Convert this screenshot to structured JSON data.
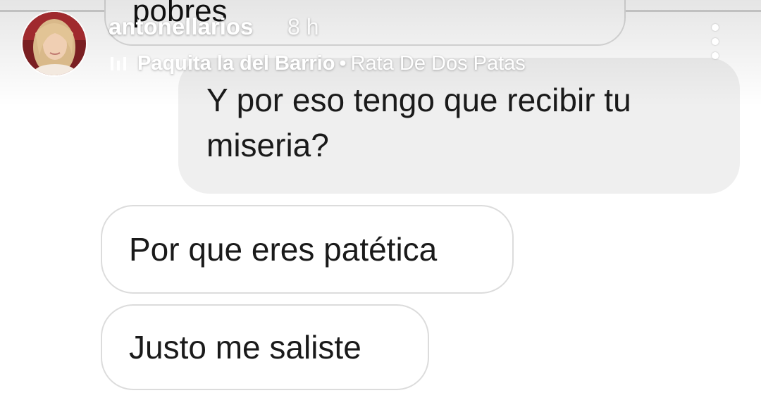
{
  "story_header": {
    "username": "antonellarios",
    "time": "8 h",
    "music": {
      "artist": "Paquita la del Barrio",
      "separator": "•",
      "song": "Rata De Dos Patas"
    },
    "avatar_icon": "profile-photo",
    "more_icon": "vertical-ellipsis"
  },
  "messages": [
    {
      "sender": "other",
      "text": "pobres",
      "style": "outlined",
      "cut_off": true
    },
    {
      "sender": "self",
      "text": "Y por eso tengo que recibir tu miseria?",
      "style": "filled"
    },
    {
      "sender": "other",
      "text": "Por que eres patética",
      "style": "outlined"
    },
    {
      "sender": "other",
      "text": "Justo me saliste",
      "style": "outlined"
    }
  ],
  "colors": {
    "own_bubble": "#efefef",
    "other_bubble_border": "#dcdcdc",
    "header_text": "#ffffff"
  }
}
